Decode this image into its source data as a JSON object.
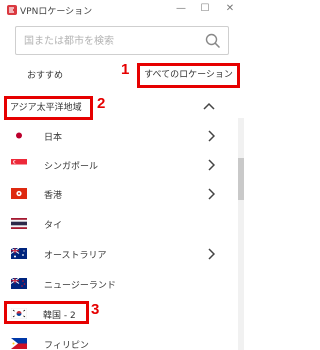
{
  "window": {
    "title": "VPNロケーション",
    "minimize": "—",
    "maximize": "☐",
    "close": "✕"
  },
  "search": {
    "placeholder": "国または都市を検索"
  },
  "tabs": [
    {
      "label": "おすすめ"
    },
    {
      "label": "すべてのロケーション"
    }
  ],
  "region": {
    "label": "アジア太平洋地域"
  },
  "countries": [
    {
      "name": "日本",
      "has_submenu": true
    },
    {
      "name": "シンガポール",
      "has_submenu": true
    },
    {
      "name": "香港",
      "has_submenu": true
    },
    {
      "name": "タイ",
      "has_submenu": false
    },
    {
      "name": "オーストラリア",
      "has_submenu": true
    },
    {
      "name": "ニュージーランド",
      "has_submenu": false
    },
    {
      "name": "韓国 - 2",
      "has_submenu": false
    },
    {
      "name": "フィリピン",
      "has_submenu": false
    }
  ],
  "annotations": [
    "1",
    "2",
    "3"
  ],
  "colors": {
    "accent": "#da3940",
    "highlight": "#e60000"
  }
}
